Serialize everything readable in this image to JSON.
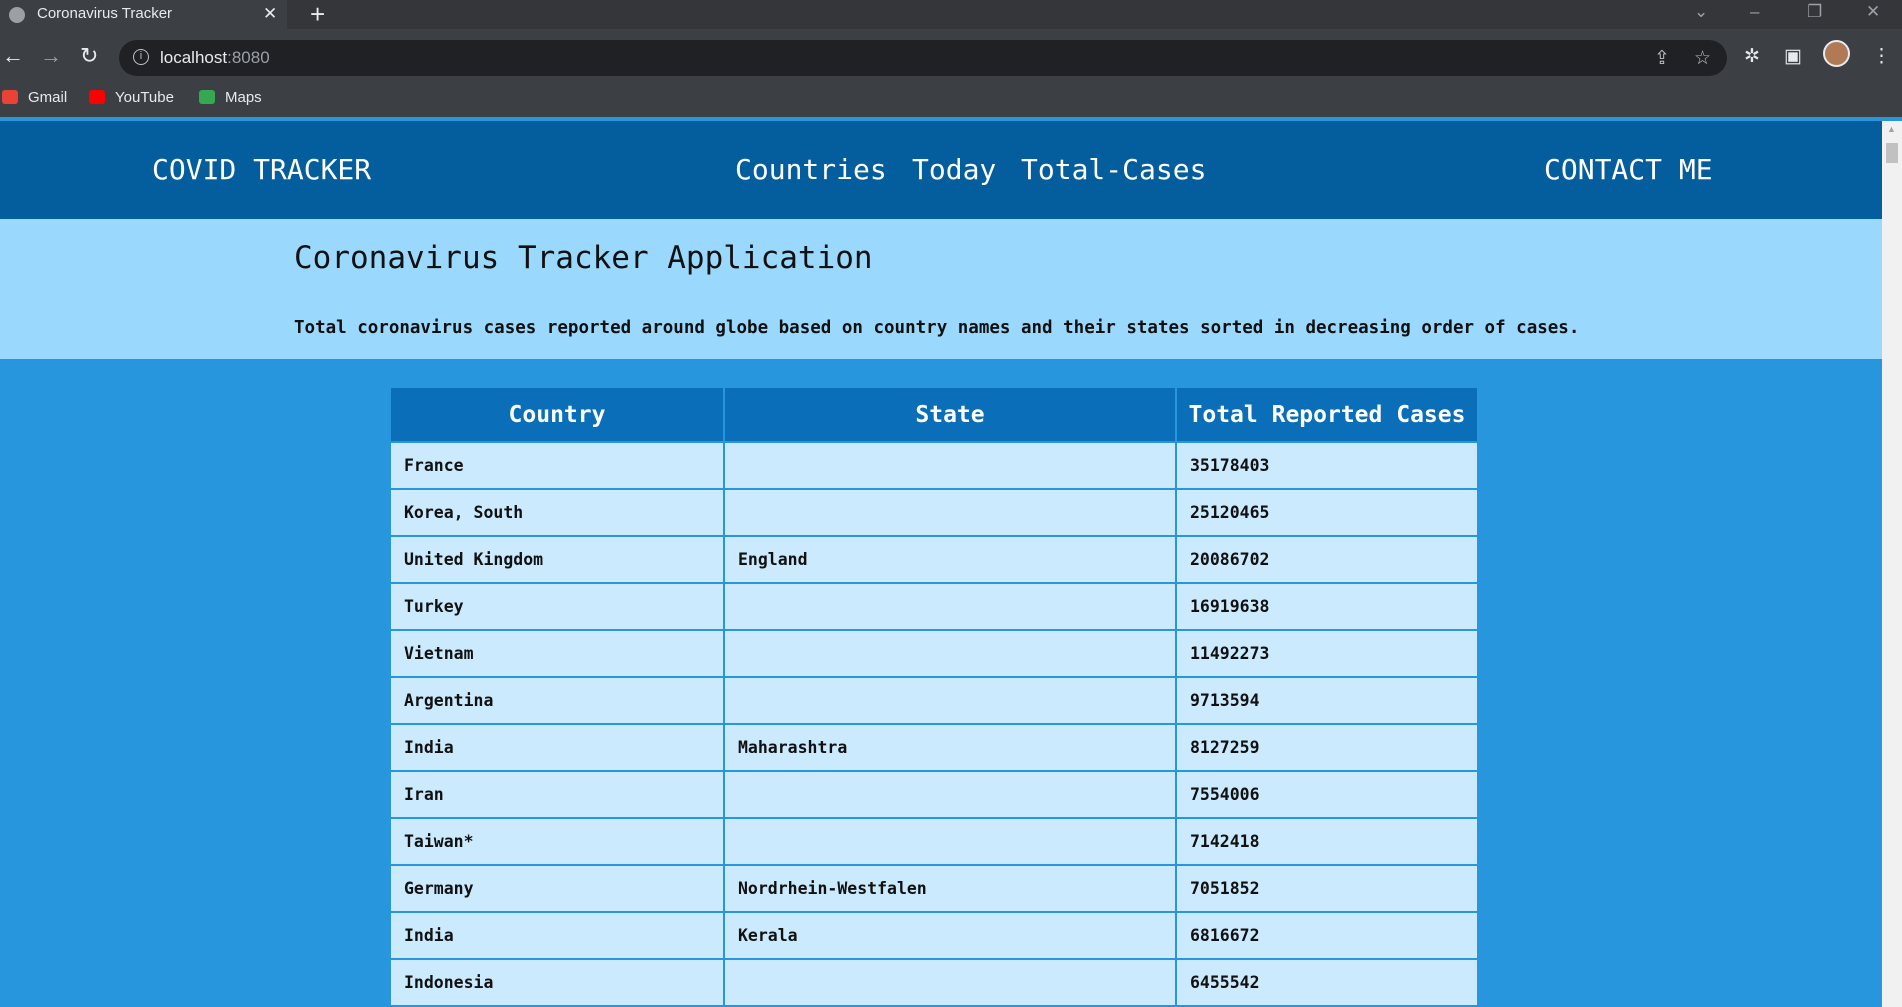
{
  "browser": {
    "tab_title": "Coronavirus Tracker",
    "url_host": "localhost",
    "url_port": ":8080",
    "bookmarks": [
      {
        "label": "Gmail",
        "icon": "gmail-icon",
        "color": "#ea4335"
      },
      {
        "label": "YouTube",
        "icon": "youtube-icon",
        "color": "#ff0000"
      },
      {
        "label": "Maps",
        "icon": "maps-icon",
        "color": "#34a853"
      }
    ]
  },
  "navbar": {
    "brand": "COVID TRACKER",
    "links": [
      "Countries",
      "Today",
      "Total-Cases"
    ],
    "contact": "CONTACT ME"
  },
  "intro": {
    "title": "Coronavirus Tracker Application",
    "description": "Total coronavirus cases reported around globe based on country names and their states sorted in decreasing order of cases."
  },
  "table": {
    "headers": [
      "Country",
      "State",
      "Total Reported Cases"
    ],
    "rows": [
      [
        "France",
        "",
        "35178403"
      ],
      [
        "Korea, South",
        "",
        "25120465"
      ],
      [
        "United Kingdom",
        "England",
        "20086702"
      ],
      [
        "Turkey",
        "",
        "16919638"
      ],
      [
        "Vietnam",
        "",
        "11492273"
      ],
      [
        "Argentina",
        "",
        "9713594"
      ],
      [
        "India",
        "Maharashtra",
        "8127259"
      ],
      [
        "Iran",
        "",
        "7554006"
      ],
      [
        "Taiwan*",
        "",
        "7142418"
      ],
      [
        "Germany",
        "Nordrhein-Westfalen",
        "7051852"
      ],
      [
        "India",
        "Kerala",
        "6816672"
      ],
      [
        "Indonesia",
        "",
        "6455542"
      ]
    ]
  },
  "colors": {
    "navbar_bg": "#045e9d",
    "intro_bg": "#9ad8fd",
    "page_bg": "#2896dd",
    "table_header_bg": "#0a6fb8",
    "table_cell_bg": "#cbeafd"
  }
}
